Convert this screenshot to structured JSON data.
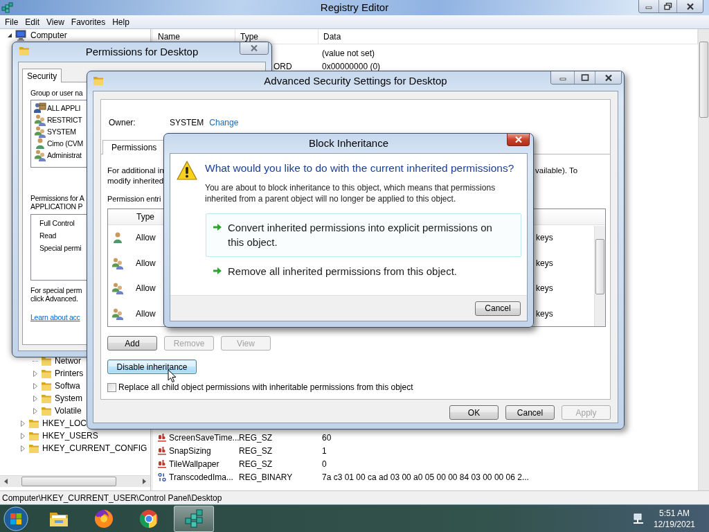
{
  "registry_editor": {
    "title": "Registry Editor",
    "menu": [
      "File",
      "Edit",
      "View",
      "Favorites",
      "Help"
    ],
    "tree": {
      "root": {
        "label": "Computer",
        "expanded": true
      },
      "subkeys": [
        {
          "label": "Networ",
          "expandable": false
        },
        {
          "label": "Printers",
          "expandable": true
        },
        {
          "label": "Softwa",
          "expandable": true
        },
        {
          "label": "System",
          "expandable": true
        },
        {
          "label": "Volatile",
          "expandable": true
        }
      ],
      "hives": [
        {
          "label": "HKEY_LOC",
          "expandable": true
        },
        {
          "label": "HKEY_USERS",
          "expandable": true
        },
        {
          "label": "HKEY_CURRENT_CONFIG",
          "expandable": true
        }
      ]
    },
    "columns": [
      "Name",
      "Type",
      "Data"
    ],
    "top_rows": [
      {
        "data": "(value not set)"
      },
      {
        "type": "ORD",
        "data": "0x00000000 (0)"
      }
    ],
    "bottom_rows": [
      {
        "kind": "string",
        "name": "ScreenSaveTime...",
        "type": "REG_SZ",
        "data": "60"
      },
      {
        "kind": "string",
        "name": "SnapSizing",
        "type": "REG_SZ",
        "data": "1"
      },
      {
        "kind": "string",
        "name": "TileWallpaper",
        "type": "REG_SZ",
        "data": "0"
      },
      {
        "kind": "binary",
        "name": "TranscodedIma...",
        "type": "REG_BINARY",
        "data": "7a c3 01 00 ca ad 03 00 a0 05 00 00 84 03 00 00 06 2..."
      }
    ],
    "status_bar": "Computer\\HKEY_CURRENT_USER\\Control Panel\\Desktop"
  },
  "permissions_dialog": {
    "title": "Permissions for Desktop",
    "tabs": [
      {
        "label": "Security",
        "selected": true
      }
    ],
    "group_label": "Group or user na",
    "users": [
      {
        "kind": "package",
        "name": "ALL APPLI"
      },
      {
        "kind": "group",
        "name": "RESTRICT"
      },
      {
        "kind": "group",
        "name": "SYSTEM"
      },
      {
        "kind": "user",
        "name": "Cimo (CVM"
      },
      {
        "kind": "group",
        "name": "Administrat"
      }
    ],
    "permissions_label": [
      "Permissions for A",
      "APPLICATION P"
    ],
    "permissions": [
      "Full Control",
      "Read",
      "Special permi"
    ],
    "special_note": [
      "For special perm",
      "click Advanced."
    ],
    "link": "Learn about acc"
  },
  "advanced_dialog": {
    "title": "Advanced Security Settings for Desktop",
    "owner_label": "Owner:",
    "owner": "SYSTEM",
    "change_link": "Change",
    "tabs": [
      {
        "label": "Permissions",
        "selected": true
      }
    ],
    "info_left": [
      "For additional in",
      "modify inherited"
    ],
    "info_right": "vailable). To",
    "entries_label": "Permission entri",
    "columns": [
      "Type"
    ],
    "entries": [
      {
        "kind": "user",
        "type": "Allow",
        "column_tail": "keys"
      },
      {
        "kind": "group",
        "type": "Allow",
        "column_tail": "keys"
      },
      {
        "kind": "group",
        "type": "Allow",
        "column_tail": "keys"
      },
      {
        "kind": "group",
        "type": "Allow",
        "column_tail": "keys"
      }
    ],
    "buttons": [
      {
        "label": "Add",
        "disabled": false
      },
      {
        "label": "Remove",
        "disabled": true
      },
      {
        "label": "View",
        "disabled": true
      }
    ],
    "disable_inheritance": {
      "label": "Disable inheritance",
      "focused": true
    },
    "replace_checkbox": {
      "label": "Replace all child object permissions with inheritable permissions from this object",
      "checked": false
    },
    "footer_buttons": [
      {
        "label": "OK",
        "disabled": false
      },
      {
        "label": "Cancel",
        "disabled": false
      },
      {
        "label": "Apply",
        "disabled": true
      }
    ]
  },
  "block_dialog": {
    "title": "Block Inheritance",
    "question": "What would you like to do with the current inherited permissions?",
    "description": [
      "You are about to block inheritance to this object, which means that permissions",
      "inherited from a parent object will no longer be applied to this object."
    ],
    "options": [
      {
        "label": "Convert inherited permissions into explicit permissions on this object.",
        "selected": true
      },
      {
        "label": "Remove all inherited permissions from this object.",
        "selected": false
      }
    ],
    "cancel": "Cancel"
  },
  "taskbar": {
    "apps": [
      {
        "kind": "explorer",
        "active": false
      },
      {
        "kind": "firefox",
        "active": false
      },
      {
        "kind": "chrome",
        "active": false
      },
      {
        "kind": "regedit",
        "active": true
      }
    ],
    "clock": {
      "time": "5:51 AM",
      "date": "12/19/2021"
    }
  }
}
